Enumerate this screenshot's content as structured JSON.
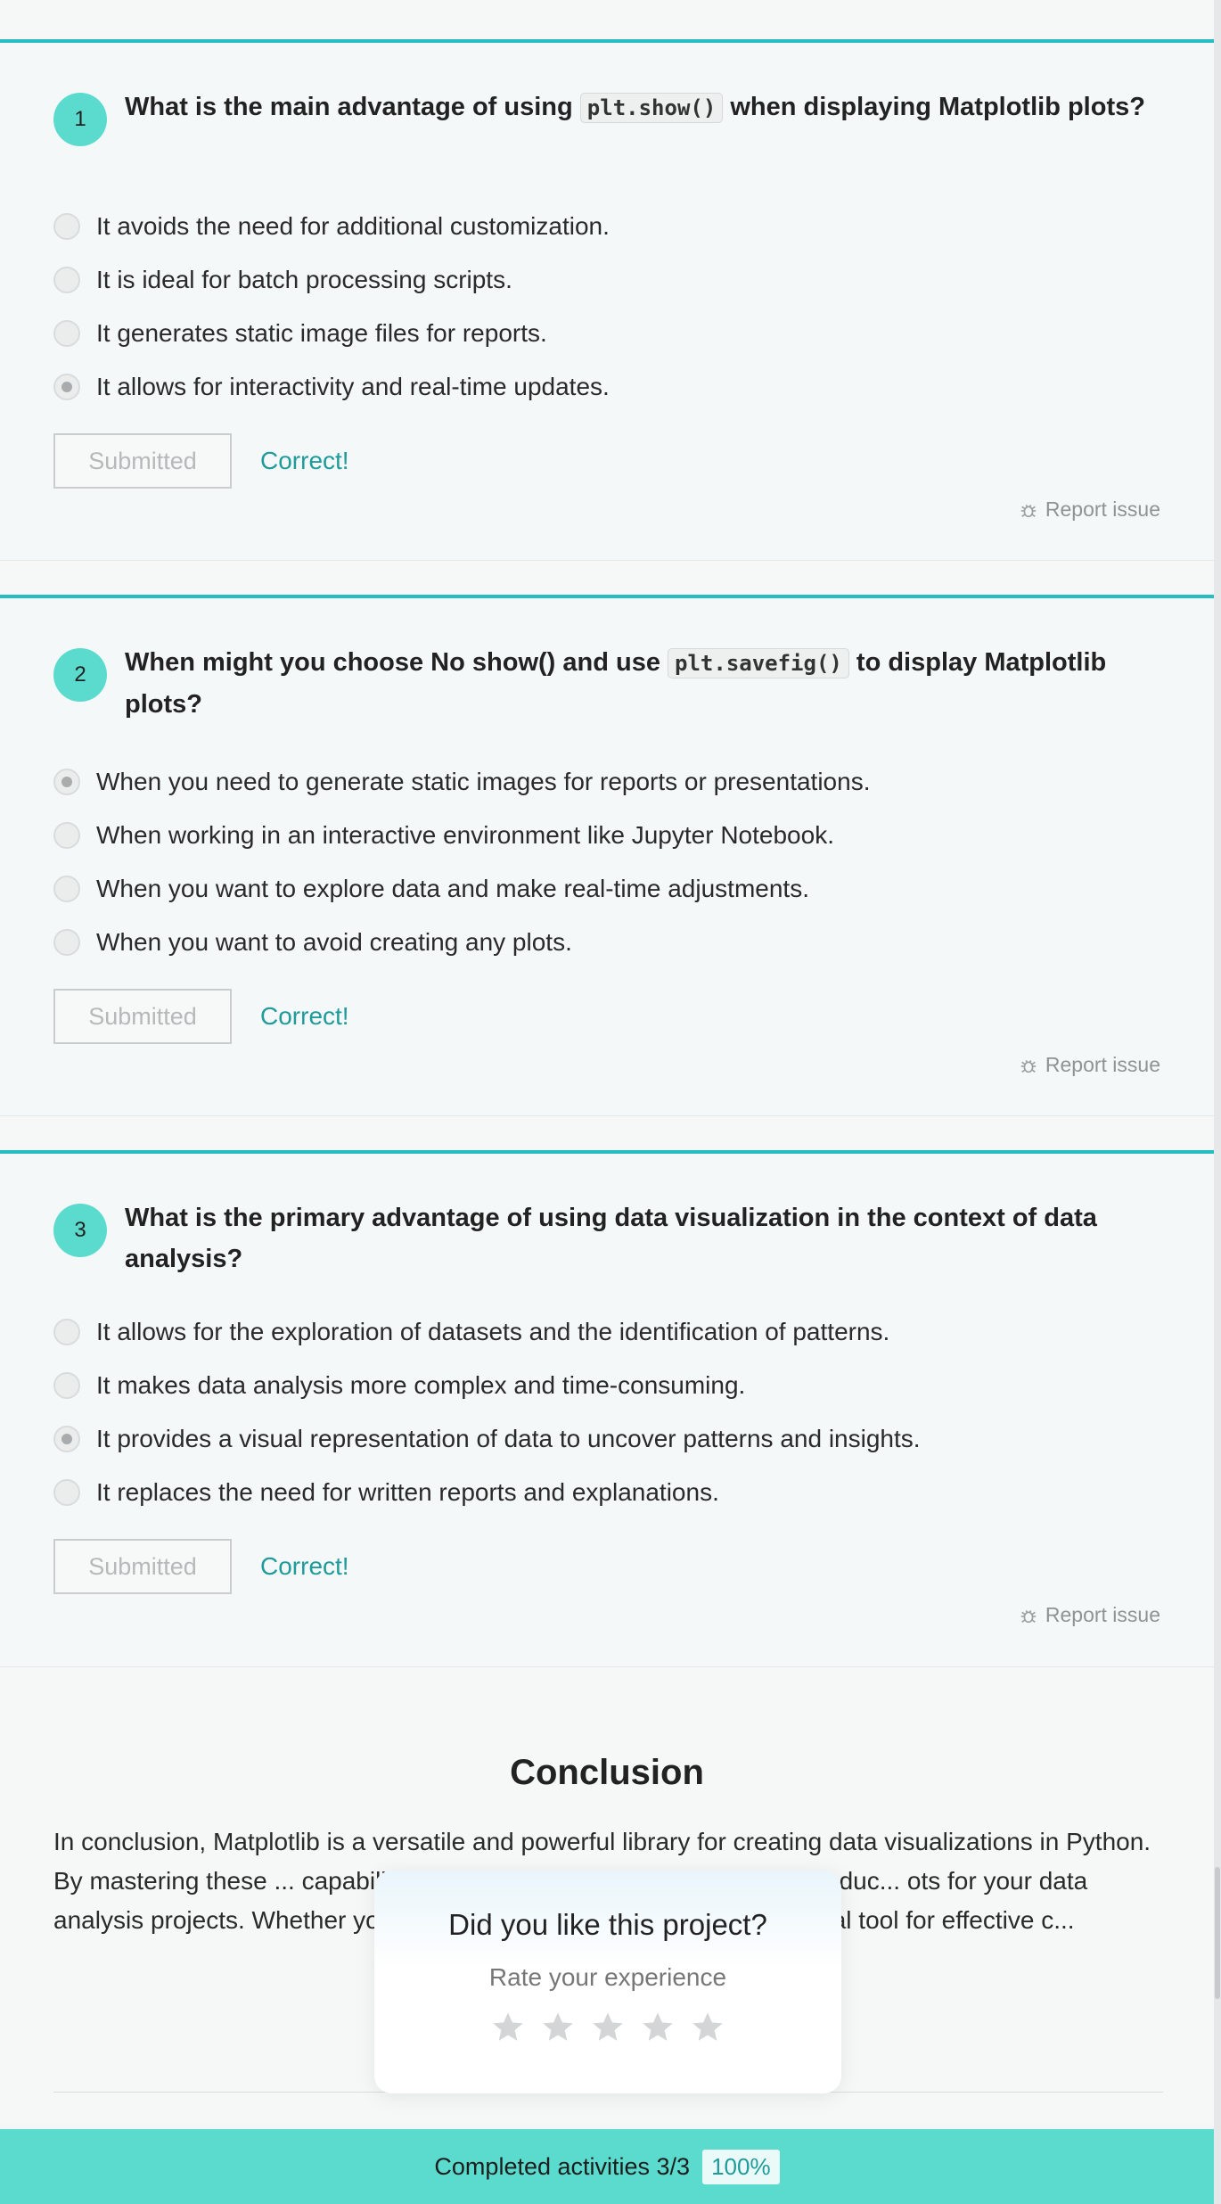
{
  "questions": [
    {
      "number": "1",
      "text_before": "What is the main advantage of using ",
      "code": "plt.show()",
      "text_after": " when displaying Matplotlib plots?",
      "options": [
        "It avoids the need for additional customization.",
        "It is ideal for batch processing scripts.",
        "It generates static image files for reports.",
        "It allows for interactivity and real-time updates."
      ],
      "selected_index": 3,
      "submit_label": "Submitted",
      "feedback": "Correct!",
      "report_label": "Report issue"
    },
    {
      "number": "2",
      "text_before": "When might you choose No show() and use ",
      "code": "plt.savefig()",
      "text_after": " to display Matplotlib plots?",
      "options": [
        "When you need to generate static images for reports or presentations.",
        "When working in an interactive environment like Jupyter Notebook.",
        "When you want to explore data and make real-time adjustments.",
        "When you want to avoid creating any plots."
      ],
      "selected_index": 0,
      "submit_label": "Submitted",
      "feedback": "Correct!",
      "report_label": "Report issue"
    },
    {
      "number": "3",
      "text_before": "What is the primary advantage of using data visualization in the context of data analysis?",
      "code": "",
      "text_after": "",
      "options": [
        "It allows for the exploration of datasets and the identification of patterns.",
        "It makes data analysis more complex and time-consuming.",
        "It provides a visual representation of data to uncover patterns and insights.",
        "It replaces the need for written reports and explanations."
      ],
      "selected_index": 2,
      "submit_label": "Submitted",
      "feedback": "Correct!",
      "report_label": "Report issue"
    }
  ],
  "conclusion": {
    "title": "Conclusion",
    "body": "In conclusion, Matplotlib is a versatile and powerful library for creating data visualizations in Python. By mastering these ... capabilities further, you'll be well-equipped to produc... ots for your data analysis projects. Whether you're a ... st, Matplotlib remains an essential tool for effective c..."
  },
  "rating_popup": {
    "title": "Did you like this project?",
    "subtitle": "Rate your experience",
    "stars": 5
  },
  "progress_bar": {
    "label": "Completed activities 3/3",
    "percent": "100%"
  },
  "colors": {
    "accent": "#5bdbce",
    "card_border": "#25bdc2",
    "feedback": "#1f9b9b"
  }
}
